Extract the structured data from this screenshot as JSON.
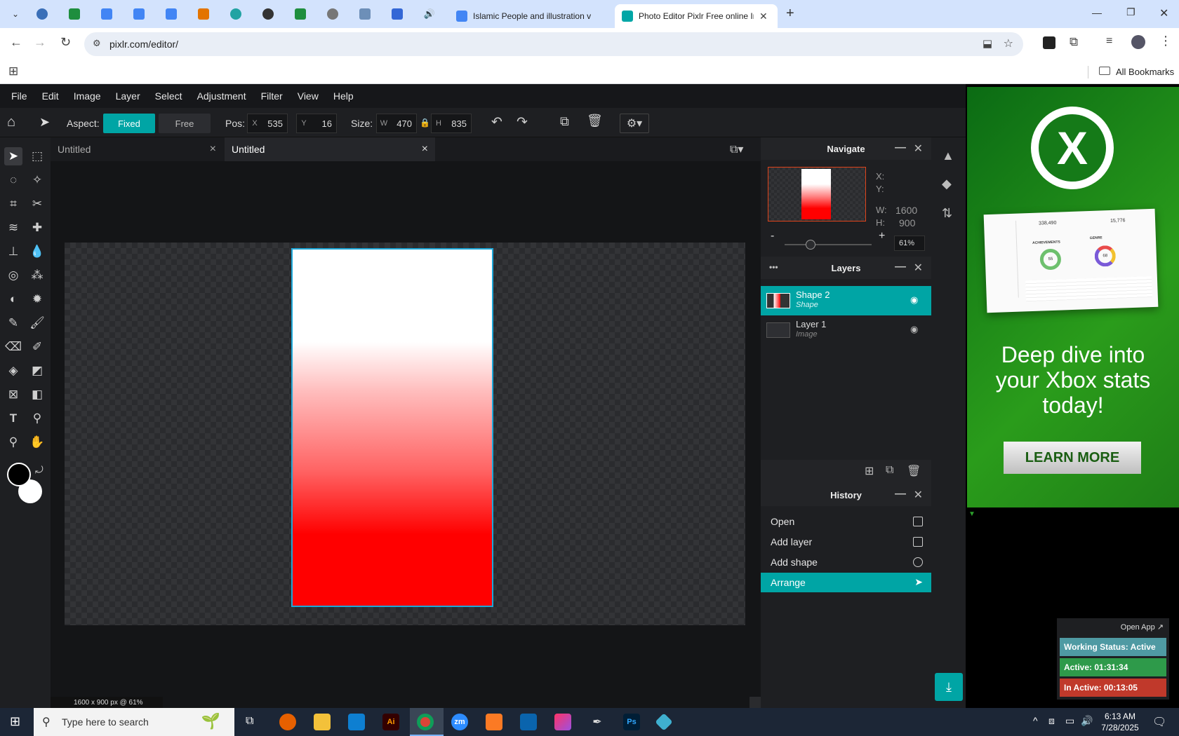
{
  "browser": {
    "tabs": [
      {
        "title": "Islamic People and illustration v",
        "favicon_color": "#4285f4"
      },
      {
        "title": "Photo Editor Pixlr Free online In",
        "favicon_color": "#00a6a6",
        "active": true
      }
    ],
    "new_tab": "+",
    "url": "pixlr.com/editor/",
    "bookmarks_label": "All Bookmarks"
  },
  "app": {
    "menu": [
      "File",
      "Edit",
      "Image",
      "Layer",
      "Select",
      "Adjustment",
      "Filter",
      "View",
      "Help"
    ],
    "options": {
      "aspect_label": "Aspect:",
      "fixed_label": "Fixed",
      "free_label": "Free",
      "pos_label": "Pos:",
      "x_label": "X",
      "x_value": "535",
      "y_label": "Y",
      "y_value": "16",
      "size_label": "Size:",
      "w_label": "W",
      "w_value": "470",
      "h_label": "H",
      "h_value": "835"
    },
    "doc_tabs": [
      {
        "title": "Untitled",
        "close": "×"
      },
      {
        "title": "Untitled",
        "close": "×",
        "active": true
      }
    ],
    "status": "1600 x 900 px @ 61%",
    "navigate": {
      "title": "Navigate",
      "x_label": "X:",
      "y_label": "Y:",
      "w_label": "W:",
      "w_value": "1600",
      "h_label": "H:",
      "h_value": "900",
      "zoom_minus": "-",
      "zoom_plus": "+",
      "zoom": "61%",
      "zoom_slider_fraction": 0.3
    },
    "layers": {
      "title": "Layers",
      "more": "•••",
      "items": [
        {
          "name": "Shape 2",
          "type": "Shape",
          "selected": true
        },
        {
          "name": "Layer 1",
          "type": "Image",
          "selected": false
        }
      ]
    },
    "history": {
      "title": "History",
      "items": [
        {
          "label": "Open",
          "icon": "document-icon"
        },
        {
          "label": "Add layer",
          "icon": "square-icon"
        },
        {
          "label": "Add shape",
          "icon": "shapes-icon"
        },
        {
          "label": "Arrange",
          "icon": "arrow-cursor-icon",
          "selected": true
        }
      ]
    },
    "accent": "#00a5a5"
  },
  "ad": {
    "headline": "Deep dive into your Xbox stats today!",
    "button": "LEARN MORE",
    "dashboard_numbers": [
      "338,490",
      "15,776",
      "55",
      "68"
    ],
    "dashboard_labels": [
      "ACHIEVEMENTS",
      "GENRE"
    ]
  },
  "widget": {
    "open_app": "Open App ↗",
    "working": "Working Status: Active",
    "active": "Active: 01:31:34",
    "inactive": "In Active: 00:13:05"
  },
  "taskbar": {
    "search_placeholder": "Type here to search",
    "time": "6:13 AM",
    "date": "7/28/2025",
    "apps": [
      "Ai",
      "zm",
      "Ps"
    ]
  }
}
